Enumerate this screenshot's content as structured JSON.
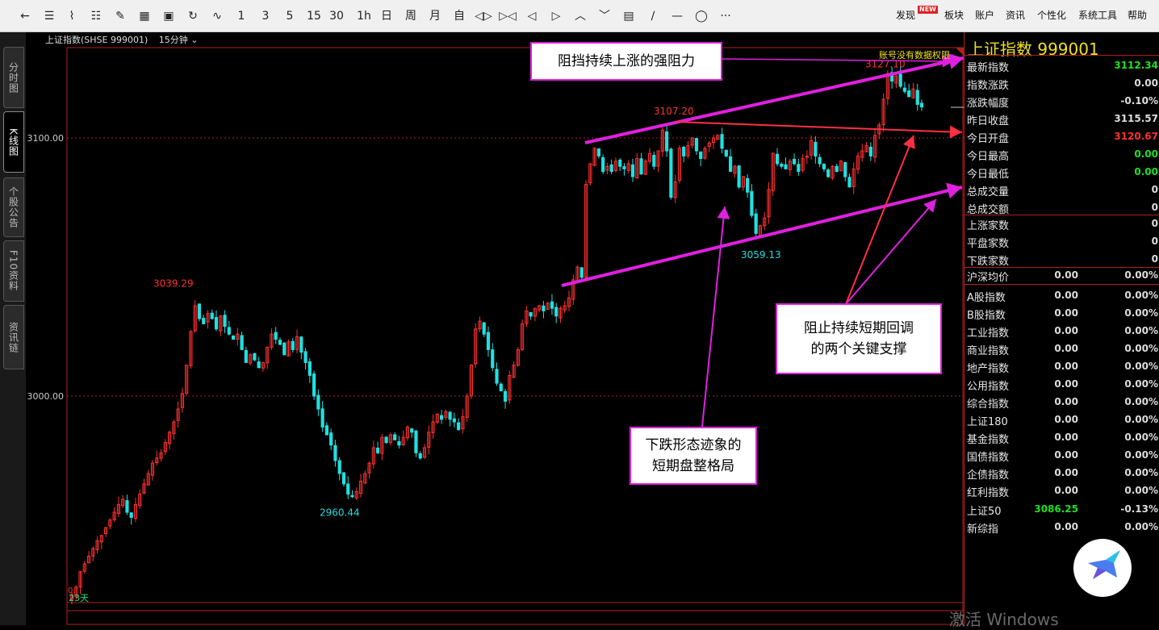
{
  "toolbar": {
    "buttons": [
      {
        "name": "back",
        "label": "←"
      },
      {
        "name": "list",
        "label": "☰"
      },
      {
        "name": "line",
        "label": "⌇"
      },
      {
        "name": "candle",
        "label": "☷"
      },
      {
        "name": "draw",
        "label": "✎"
      },
      {
        "name": "layout",
        "label": "▦"
      },
      {
        "name": "save",
        "label": "▣"
      },
      {
        "name": "refresh",
        "label": "↻"
      },
      {
        "name": "indicator",
        "label": "∿"
      },
      {
        "name": "p1",
        "label": "1"
      },
      {
        "name": "p3",
        "label": "3"
      },
      {
        "name": "p5",
        "label": "5"
      },
      {
        "name": "p15",
        "label": "15"
      },
      {
        "name": "p30",
        "label": "30"
      },
      {
        "name": "p1h",
        "label": "1h"
      },
      {
        "name": "day",
        "label": "日"
      },
      {
        "name": "week",
        "label": "周"
      },
      {
        "name": "month",
        "label": "月"
      },
      {
        "name": "custom",
        "label": "自"
      },
      {
        "name": "expand",
        "label": "◁▷"
      },
      {
        "name": "shrink",
        "label": "▷◁"
      },
      {
        "name": "left",
        "label": "◁"
      },
      {
        "name": "right",
        "label": "▷"
      },
      {
        "name": "up",
        "label": "︿"
      },
      {
        "name": "down",
        "label": "﹀"
      },
      {
        "name": "table",
        "label": "▤"
      },
      {
        "name": "trendline",
        "label": "∕"
      },
      {
        "name": "hline",
        "label": "—"
      },
      {
        "name": "ellipse",
        "label": "◯"
      },
      {
        "name": "more",
        "label": "···"
      }
    ],
    "menus": [
      "发现",
      "板块",
      "账户",
      "资讯",
      "个性化",
      "系统工具",
      "帮助"
    ],
    "new_badge": "NEW"
  },
  "sidebar": {
    "tabs": [
      {
        "label": "分时图",
        "active": false
      },
      {
        "label": "K线图",
        "active": true
      },
      {
        "label": "个股公告",
        "active": false
      },
      {
        "label": "F10资料",
        "active": false
      },
      {
        "label": "资讯链",
        "active": false
      }
    ]
  },
  "chart_header": {
    "title": "上证指数(SHSE 999001)",
    "period": "15分钟",
    "no_permission": "账号没有数据权限"
  },
  "chart_data": {
    "type": "candlestick",
    "axis_labels": [
      "3100.00",
      "3000.00"
    ],
    "axis_ticks": [
      3100,
      3000
    ],
    "price_labels": {
      "high1": "3039.29",
      "low1": "2960.44",
      "high2": "3107.20",
      "low2": "3059.13",
      "high3": "3127.10"
    },
    "bottom_label": "23天",
    "bottom_digit": "0",
    "ylim": [
      2920,
      3135
    ],
    "closes": [
      2923,
      2926,
      2932,
      2935,
      2938,
      2941,
      2944,
      2946,
      2949,
      2952,
      2955,
      2958,
      2960,
      2955,
      2953,
      2958,
      2962,
      2966,
      2970,
      2974,
      2976,
      2978,
      2982,
      2986,
      2990,
      2995,
      3001,
      3012,
      3025,
      3035,
      3030,
      3028,
      3032,
      3030,
      3026,
      3031,
      3027,
      3024,
      3022,
      3024,
      3018,
      3013,
      3016,
      3014,
      3011,
      3013,
      3019,
      3024,
      3022,
      3020,
      3016,
      3021,
      3018,
      3023,
      3017,
      3013,
      3008,
      3000,
      2995,
      2988,
      2985,
      2981,
      2975,
      2970,
      2966,
      2962,
      2961,
      2963,
      2967,
      2970,
      2974,
      2980,
      2978,
      2984,
      2982,
      2985,
      2983,
      2981,
      2984,
      2988,
      2986,
      2978,
      2976,
      2980,
      2986,
      2990,
      2993,
      2991,
      2994,
      2991,
      2990,
      2987,
      2992,
      3000,
      3012,
      3026,
      3029,
      3024,
      3018,
      3011,
      3005,
      3002,
      2998,
      3008,
      3012,
      3018,
      3028,
      3033,
      3031,
      3034,
      3035,
      3033,
      3036,
      3034,
      3031,
      3034,
      3035,
      3038,
      3045,
      3050,
      3046,
      3082,
      3090,
      3096,
      3093,
      3087,
      3089,
      3087,
      3091,
      3089,
      3088,
      3090,
      3085,
      3092,
      3086,
      3091,
      3094,
      3089,
      3095,
      3103,
      3095,
      3077,
      3083,
      3096,
      3093,
      3097,
      3100,
      3095,
      3092,
      3096,
      3098,
      3100,
      3101,
      3096,
      3093,
      3087,
      3089,
      3081,
      3085,
      3079,
      3070,
      3063,
      3066,
      3069,
      3080,
      3094,
      3090,
      3089,
      3088,
      3091,
      3090,
      3087,
      3092,
      3093,
      3099,
      3093,
      3090,
      3088,
      3085,
      3089,
      3087,
      3091,
      3085,
      3081,
      3088,
      3093,
      3095,
      3097,
      3093,
      3101,
      3105,
      3115,
      3125,
      3122,
      3124,
      3120,
      3118,
      3116,
      3119,
      3113,
      3112
    ]
  },
  "annotations": [
    {
      "id": "resistance",
      "text": "阻挡持续上涨的强阻力"
    },
    {
      "id": "support",
      "text": "阻止持续短期回调\n的两个关键支撑"
    },
    {
      "id": "consolidation",
      "text": "下跌形态迹象的\n短期盘整格局"
    }
  ],
  "quote_panel": {
    "title": "上证指数  999001",
    "rows1": [
      {
        "label": "最新指数",
        "value": "3112.34",
        "color": "#20e020"
      },
      {
        "label": "指数涨跌",
        "value": "0.00",
        "color": "#dddddd"
      },
      {
        "label": "涨跌幅度",
        "value": "-0.10%",
        "color": "#dddddd"
      },
      {
        "label": "昨日收盘",
        "value": "3115.57",
        "color": "#dddddd"
      },
      {
        "label": "今日开盘",
        "value": "3120.67",
        "color": "#ff3030"
      },
      {
        "label": "今日最高",
        "value": "0.00",
        "color": "#20e020"
      },
      {
        "label": "今日最低",
        "value": "0.00",
        "color": "#20e020"
      },
      {
        "label": "总成交量",
        "value": "0",
        "color": "#dddddd"
      },
      {
        "label": "总成交额",
        "value": "0",
        "color": "#dddddd"
      }
    ],
    "rows2": [
      {
        "label": "上涨家数",
        "value": "0"
      },
      {
        "label": "平盘家数",
        "value": "0"
      },
      {
        "label": "下跌家数",
        "value": "0"
      }
    ],
    "avg": {
      "label": "沪深均价",
      "v1": "0.00",
      "v2": "0.00%"
    },
    "rows3": [
      {
        "label": "A股指数",
        "v1": "0.00",
        "v2": "0.00%",
        "c1": "#dddddd"
      },
      {
        "label": "B股指数",
        "v1": "0.00",
        "v2": "0.00%",
        "c1": "#dddddd"
      },
      {
        "label": "工业指数",
        "v1": "0.00",
        "v2": "0.00%",
        "c1": "#dddddd"
      },
      {
        "label": "商业指数",
        "v1": "0.00",
        "v2": "0.00%",
        "c1": "#dddddd"
      },
      {
        "label": "地产指数",
        "v1": "0.00",
        "v2": "0.00%",
        "c1": "#dddddd"
      },
      {
        "label": "公用指数",
        "v1": "0.00",
        "v2": "0.00%",
        "c1": "#dddddd"
      },
      {
        "label": "综合指数",
        "v1": "0.00",
        "v2": "0.00%",
        "c1": "#dddddd"
      },
      {
        "label": "上证180",
        "v1": "0.00",
        "v2": "0.00%",
        "c1": "#dddddd"
      },
      {
        "label": "基金指数",
        "v1": "0.00",
        "v2": "0.00%",
        "c1": "#dddddd"
      },
      {
        "label": "国债指数",
        "v1": "0.00",
        "v2": "0.00%",
        "c1": "#dddddd"
      },
      {
        "label": "企债指数",
        "v1": "0.00",
        "v2": "0.00%",
        "c1": "#dddddd"
      },
      {
        "label": "红利指数",
        "v1": "0.00",
        "v2": "0.00%",
        "c1": "#dddddd"
      },
      {
        "label": "上证50",
        "v1": "3086.25",
        "v2": "-0.13%",
        "c1": "#20e020"
      },
      {
        "label": "新综指",
        "v1": "0.00",
        "v2": "0.00%",
        "c1": "#dddddd"
      }
    ]
  },
  "watermark": "激活 Windows",
  "colors": {
    "up": "#ff3030",
    "down": "#20e0e0",
    "accent": "#e020e0",
    "frame": "#b02020",
    "resist_arrow": "#ff3040"
  }
}
